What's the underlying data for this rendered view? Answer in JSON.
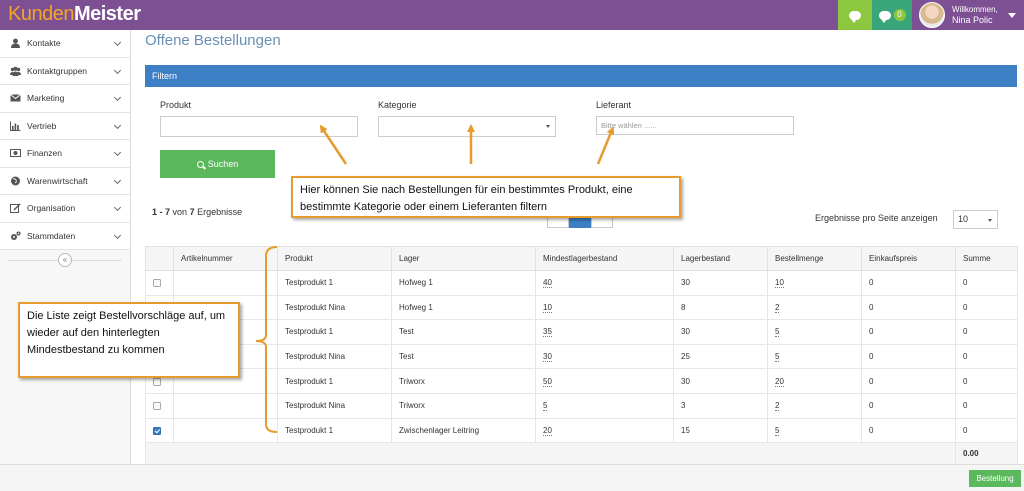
{
  "app": {
    "logo_part1": "Kunden",
    "logo_part2": "Meister",
    "notifications_count": "0",
    "user_greeting": "Willkommen,",
    "user_name": "Nina Polic"
  },
  "sidebar": {
    "items": [
      {
        "label": "Kontakte",
        "icon": "user-icon"
      },
      {
        "label": "Kontaktgruppen",
        "icon": "users-icon"
      },
      {
        "label": "Marketing",
        "icon": "envelope-icon"
      },
      {
        "label": "Vertrieb",
        "icon": "bar-chart-icon"
      },
      {
        "label": "Finanzen",
        "icon": "money-icon"
      },
      {
        "label": "Warenwirtschaft",
        "icon": "globe-icon"
      },
      {
        "label": "Organisation",
        "icon": "edit-icon"
      },
      {
        "label": "Stammdaten",
        "icon": "cogs-icon"
      }
    ],
    "collapse_glyph": "«"
  },
  "page": {
    "title": "Offene Bestellungen"
  },
  "filter": {
    "header": "Filtern",
    "product_label": "Produkt",
    "category_label": "Kategorie",
    "supplier_label": "Lieferant",
    "supplier_placeholder": "Bitte wählen ......",
    "search_button": "Suchen"
  },
  "results": {
    "range": "1 - 7",
    "of_word": "von",
    "total": "7",
    "results_word": "Ergebnisse",
    "per_page_label": "Ergebnisse pro Seite anzeigen",
    "per_page_value": "10"
  },
  "table": {
    "headers": [
      "",
      "Artikelnummer",
      "Produkt",
      "Lager",
      "Mindestlagerbestand",
      "Lagerbestand",
      "Bestellmenge",
      "Einkaufspreis",
      "Summe"
    ],
    "rows": [
      {
        "checked": false,
        "article": "",
        "product": "Testprodukt 1",
        "warehouse": "Hofweg 1",
        "min_stock": "40",
        "stock": "30",
        "order_qty": "10",
        "price": "0",
        "sum": "0"
      },
      {
        "checked": false,
        "article": "",
        "product": "Testprodukt Nina",
        "warehouse": "Hofweg 1",
        "min_stock": "10",
        "stock": "8",
        "order_qty": "2",
        "price": "0",
        "sum": "0"
      },
      {
        "checked": false,
        "article": "",
        "product": "Testprodukt 1",
        "warehouse": "Test",
        "min_stock": "35",
        "stock": "30",
        "order_qty": "5",
        "price": "0",
        "sum": "0"
      },
      {
        "checked": false,
        "article": "",
        "product": "Testprodukt Nina",
        "warehouse": "Test",
        "min_stock": "30",
        "stock": "25",
        "order_qty": "5",
        "price": "0",
        "sum": "0"
      },
      {
        "checked": false,
        "article": "",
        "product": "Testprodukt 1",
        "warehouse": "Triworx",
        "min_stock": "50",
        "stock": "30",
        "order_qty": "20",
        "price": "0",
        "sum": "0"
      },
      {
        "checked": false,
        "article": "",
        "product": "Testprodukt Nina",
        "warehouse": "Triworx",
        "min_stock": "5",
        "stock": "3",
        "order_qty": "2",
        "price": "0",
        "sum": "0"
      },
      {
        "checked": true,
        "article": "",
        "product": "Testprodukt 1",
        "warehouse": "Zwischenlager Leitring",
        "min_stock": "20",
        "stock": "15",
        "order_qty": "5",
        "price": "0",
        "sum": "0"
      }
    ],
    "total_sum": "0.00"
  },
  "footer": {
    "order_button": "Bestellung"
  },
  "annotations": {
    "top": "Hier können Sie nach Bestellungen für ein bestimmtes Produkt, eine bestimmte Kategorie oder einem Lieferanten  filtern",
    "left": "Die Liste zeigt Bestellvorschläge auf, um wieder auf den hinterlegten Mindestbestand zu kommen"
  },
  "colors": {
    "topbar": "#7c5093",
    "accent_blue": "#3c7fc5",
    "button_green": "#5cb85c",
    "logo_orange": "#f5a623",
    "callout_border": "#e69b2e"
  }
}
